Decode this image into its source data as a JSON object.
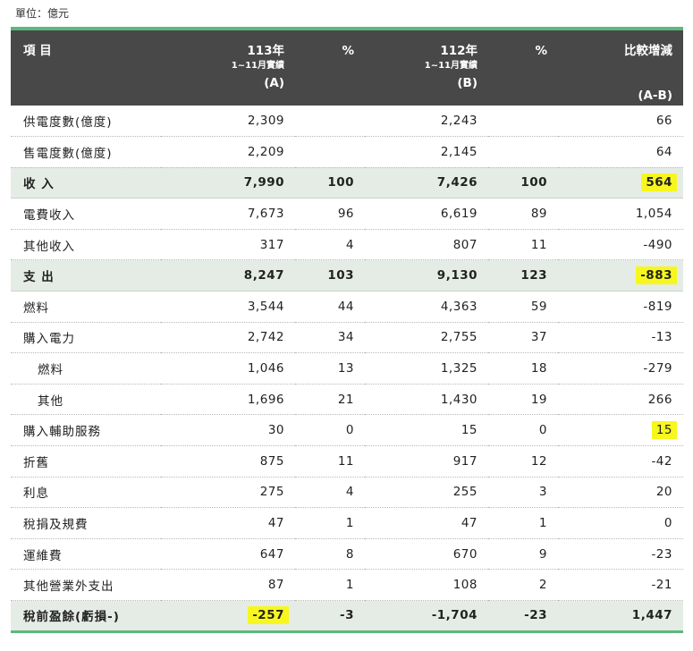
{
  "unit_label": "單位：億元",
  "header": {
    "item": "項 目",
    "col_a": {
      "year": "113年",
      "period": "1~11月實績",
      "code": "(A)"
    },
    "pct_a": "%",
    "col_b": {
      "year": "112年",
      "period": "1~11月實績",
      "code": "(B)"
    },
    "pct_b": "%",
    "diff": {
      "label": "比較增減",
      "code": "(A-B)"
    }
  },
  "rows": [
    {
      "label": "供電度數(億度)",
      "a": "2,309",
      "pa": "",
      "b": "2,243",
      "pb": "",
      "d": "66"
    },
    {
      "label": "售電度數(億度)",
      "a": "2,209",
      "pa": "",
      "b": "2,145",
      "pb": "",
      "d": "64"
    },
    {
      "label": "收 入",
      "a": "7,990",
      "pa": "100",
      "b": "7,426",
      "pb": "100",
      "d": "564"
    },
    {
      "label": "電費收入",
      "a": "7,673",
      "pa": "96",
      "b": "6,619",
      "pb": "89",
      "d": "1,054"
    },
    {
      "label": "其他收入",
      "a": "317",
      "pa": "4",
      "b": "807",
      "pb": "11",
      "d": "-490"
    },
    {
      "label": "支 出",
      "a": "8,247",
      "pa": "103",
      "b": "9,130",
      "pb": "123",
      "d": "-883"
    },
    {
      "label": "燃料",
      "a": "3,544",
      "pa": "44",
      "b": "4,363",
      "pb": "59",
      "d": "-819"
    },
    {
      "label": "購入電力",
      "a": "2,742",
      "pa": "34",
      "b": "2,755",
      "pb": "37",
      "d": "-13"
    },
    {
      "label": "燃料",
      "a": "1,046",
      "pa": "13",
      "b": "1,325",
      "pb": "18",
      "d": "-279"
    },
    {
      "label": "其他",
      "a": "1,696",
      "pa": "21",
      "b": "1,430",
      "pb": "19",
      "d": "266"
    },
    {
      "label": "購入輔助服務",
      "a": "30",
      "pa": "0",
      "b": "15",
      "pb": "0",
      "d": "15"
    },
    {
      "label": "折舊",
      "a": "875",
      "pa": "11",
      "b": "917",
      "pb": "12",
      "d": "-42"
    },
    {
      "label": "利息",
      "a": "275",
      "pa": "4",
      "b": "255",
      "pb": "3",
      "d": "20"
    },
    {
      "label": "稅捐及規費",
      "a": "47",
      "pa": "1",
      "b": "47",
      "pb": "1",
      "d": "0"
    },
    {
      "label": "運維費",
      "a": "647",
      "pa": "8",
      "b": "670",
      "pb": "9",
      "d": "-23"
    },
    {
      "label": "其他營業外支出",
      "a": "87",
      "pa": "1",
      "b": "108",
      "pb": "2",
      "d": "-21"
    },
    {
      "label": "稅前盈餘(虧損-)",
      "a": "-257",
      "pa": "-3",
      "b": "-1,704",
      "pb": "-23",
      "d": "1,447"
    }
  ],
  "colors": {
    "header_bg": "#484848",
    "accent_green": "#5cb87c",
    "summary_row_bg": "#e5ece6",
    "highlight_yellow": "#f7f71e"
  }
}
